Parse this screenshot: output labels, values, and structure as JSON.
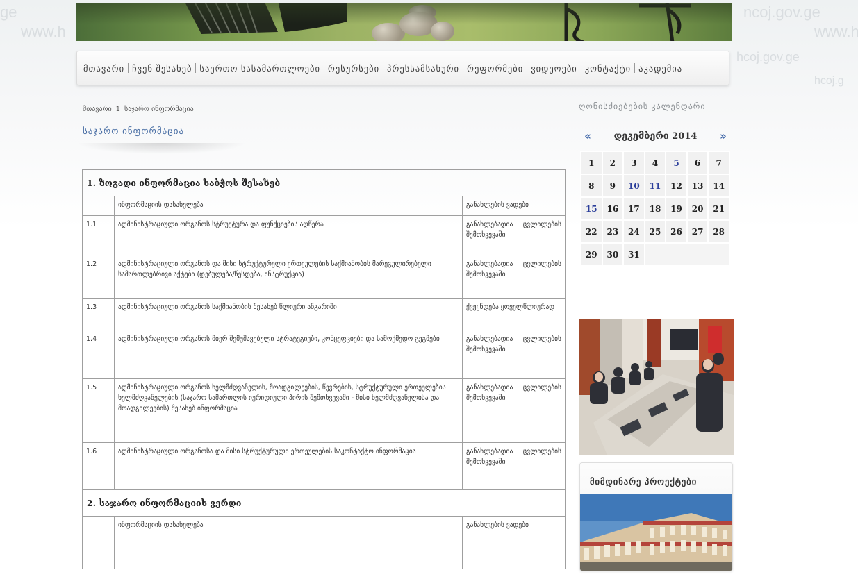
{
  "watermarks": [
    "www.h",
    "ncoj.gov.ge",
    "www.h",
    "hcoj.gov.ge",
    "hcoj.g",
    "ge"
  ],
  "nav": {
    "items": [
      "მთავარი",
      "ჩვენ შესახებ",
      "საერთო სასამართლოები",
      "რესურსები",
      "პრესსამსახური",
      "რეფორმები",
      "ვიდეოები",
      "კონტაქტი",
      "აკადემია"
    ]
  },
  "breadcrumb": {
    "home": "მთავარი",
    "separator": "1",
    "current": "საჯარო ინფორმაცია"
  },
  "page_title": "საჯარო ინფორმაცია",
  "sections": [
    {
      "title": "1. ზოგადი ინფორმაცია საბჭოს შესახებ",
      "header": {
        "doc": "ინფორმაციის დასახელება",
        "status": "განახლების ვადები"
      },
      "rows": [
        {
          "num": "1.1",
          "doc": "ადმინისტრაციული ორგანოს სტრუქტურა და ფუნქციების აღწერა",
          "status": "განახლებადია ცვლილების შემთხვევაში"
        },
        {
          "num": "1.2",
          "doc": "ადმინისტრაციული ორგანოს და მისი სტრუქტურული ერთეულების საქმიანობის მარეგულირებელი სამართლებრივი აქტები (დებულება/წესდება, ინსტრუქცია)",
          "status": "განახლებადია ცვლილების შემთხვევაში"
        },
        {
          "num": "1.3",
          "doc": "ადმინისტრაციული ორგანოს საქმიანობის შესახებ წლიური ანგარიში",
          "status": "ქვეყნდება ყოველწლიურად"
        },
        {
          "num": "1.4",
          "doc": "ადმინისტრაციული ორგანოს მიერ შემუშავებული სტრატეგიები, კონცეფციები და სამოქმედო გეგმები",
          "status": "განახლებადია ცვლილების შემთხვევაში"
        },
        {
          "num": "1.5",
          "doc": "ადმინისტრაციული ორგანოს ხელმძღვანელის, მოადგილეების, წევრების, სტრუქტურული ერთეულების ხელმძღვანელების (საჯარო სამართლის იურიდიული პირის შემთხვევაში - მისი ხელმძღვანელისა და მოადგილეების) შესახებ ინფორმაცია",
          "status": "განახლებადია ცვლილების შემთხვევაში"
        },
        {
          "num": "1.6",
          "doc": "ადმინისტრაციული ორგანოსა და მისი სტრუქტურული ერთეულების საკონტაქტო ინფორმაცია",
          "status": "განახლებადია ცვლილების შემთხვევაში"
        }
      ]
    },
    {
      "title": "2. საჯარო ინფორმაციის ვერდი",
      "header": {
        "doc": "ინფორმაციის დასახელება",
        "status": "განახლების ვადები"
      }
    }
  ],
  "sidebar": {
    "calendar_title": "ღონისძიებების კალენდარი",
    "calendar": {
      "prev": "«",
      "next": "»",
      "month": "დეკემბერი 2014",
      "weeks": [
        [
          "1",
          "2",
          "3",
          "4",
          "5",
          "6",
          "7"
        ],
        [
          "8",
          "9",
          "10",
          "11",
          "12",
          "13",
          "14"
        ],
        [
          "15",
          "16",
          "17",
          "18",
          "19",
          "20",
          "21"
        ],
        [
          "22",
          "23",
          "24",
          "25",
          "26",
          "27",
          "28"
        ],
        [
          "29",
          "30",
          "31"
        ]
      ],
      "event_days": [
        "5",
        "10",
        "11",
        "15"
      ]
    },
    "projects_title": "მიმდინარე პროექტები"
  }
}
